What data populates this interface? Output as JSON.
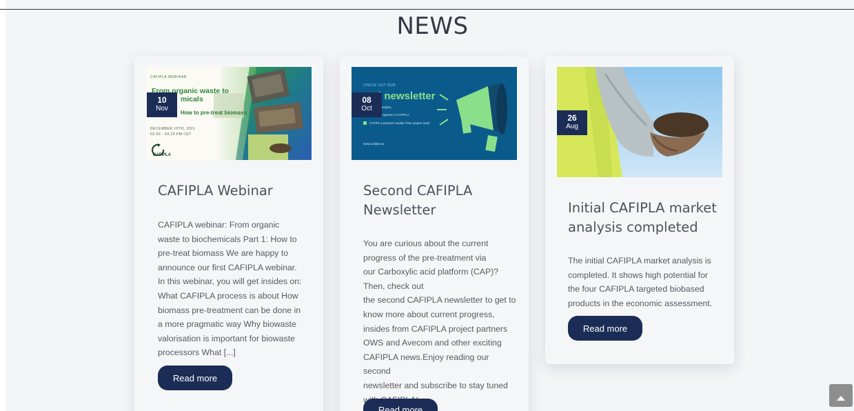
{
  "section": {
    "title": "NEWS"
  },
  "posts": [
    {
      "day": "10",
      "month": "Nov",
      "title": "CAFIPLA Webinar",
      "excerpt": "CAFIPLA webinar: From organic waste to biochemicals Part 1: How to pre-treat biomass We are happy to announce our first CAFIPLA webinar. In this webinar, you will get insides on: What CAFIPLA process is about How biomass pre-treatment can be done in a more pragmatic way Why biowaste valorisation is important for biowaste processors What [...]",
      "read_more": "Read more",
      "image": {
        "label": "CAFIPLA WEBINAR",
        "heading_1": "From organic waste to",
        "heading_2": "micals",
        "subheading": "How to pre-treat biomass",
        "date_line_1": "DECEMBER 10TH, 2021",
        "date_line_2": "03.00 - 04.15 PM CET",
        "logo": "CAFIPLA"
      }
    },
    {
      "day": "08",
      "month": "Oct",
      "title": "Second CAFIPLA Newsletter",
      "excerpt_lines": [
        "You are curious about the current",
        "progress of the pre-treatment via",
        "our Carboxylic acid platform (CAP)?",
        "Then, check out",
        "the second CAFIPLA newsletter to get to",
        "know more about current progress,",
        "insides from CAFIPLA project partners",
        "OWS and Avecom and other exciting",
        "CAFIPLA news.Enjoy reading our second",
        "newsletter and subscribe to stay tuned",
        "with CAFIPLA!"
      ],
      "read_more": "Read more",
      "image": {
        "kicker": "CHECK OUT OUR",
        "heading": "d newsletter",
        "line_1": "ket analysis",
        "line_2": "ent progress in CAFIPLA",
        "line_3": "CAFIPLA partners explain their project work",
        "footer": "www.cafipla.eu"
      }
    },
    {
      "day": "26",
      "month": "Aug",
      "title": "Initial CAFIPLA market analysis completed",
      "excerpt": "The initial CAFIPLA market analysis is completed. It shows high potential for the four CAFIPLA targeted biobased products in the economic assessment.",
      "read_more": "Read more"
    }
  ],
  "colors": {
    "accent": "#1b2d56",
    "background": "#f4f5f7",
    "newsletter_bg": "#0b5a8c",
    "green": "#8ae08a"
  },
  "icons": {
    "scroll_top": "chevron-up-icon",
    "megaphone": "megaphone-icon"
  }
}
